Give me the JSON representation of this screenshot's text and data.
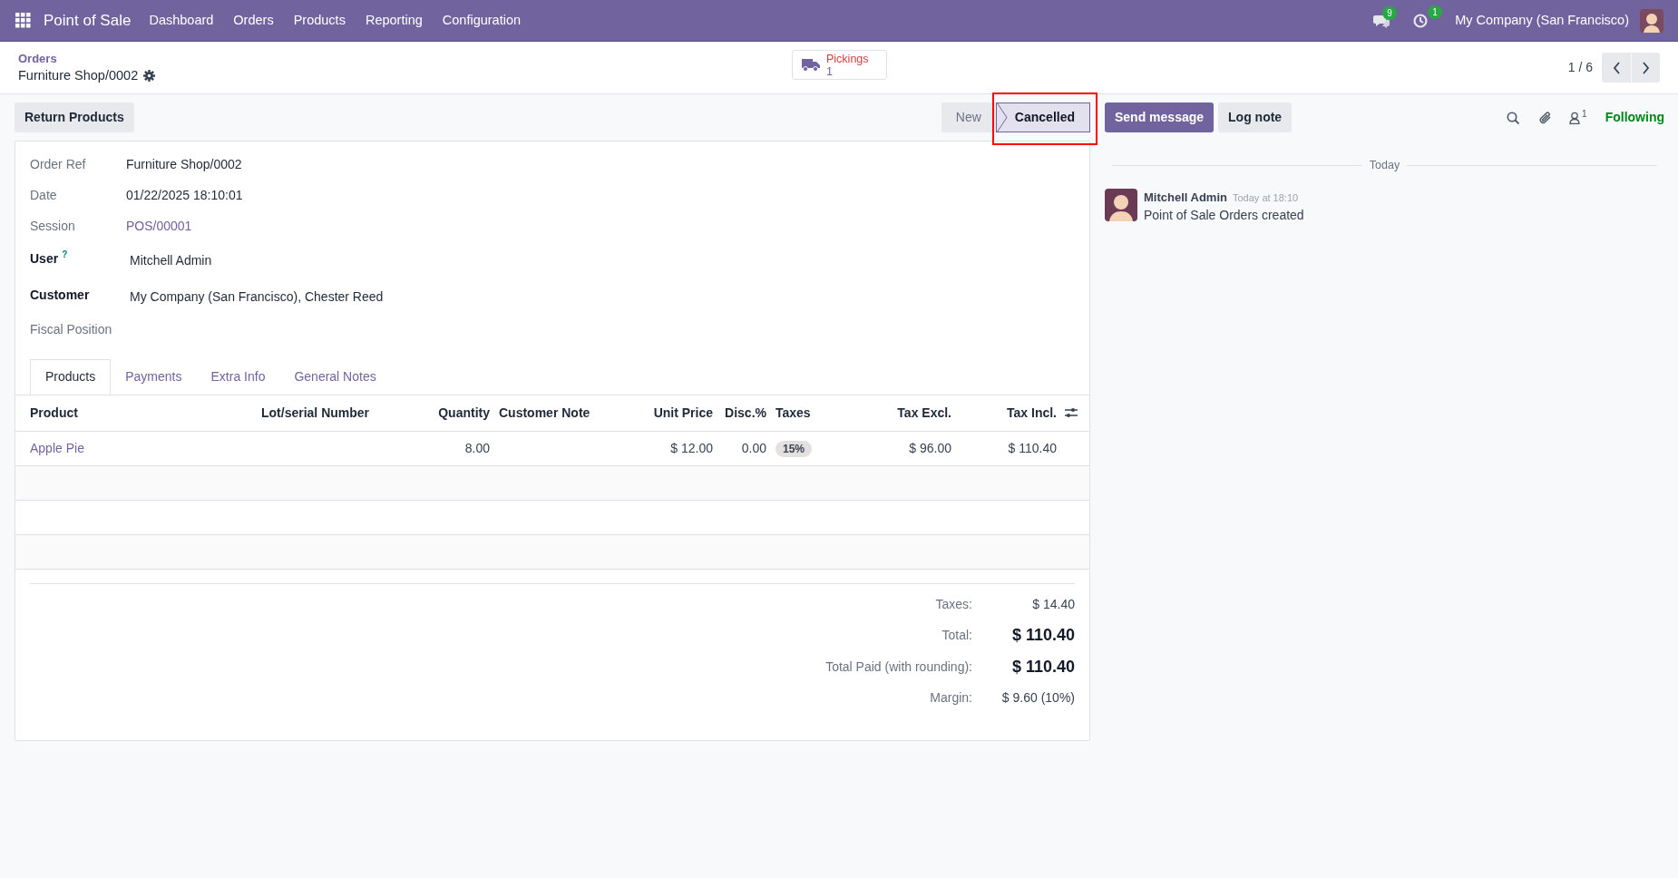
{
  "navbar": {
    "app_name": "Point of Sale",
    "menu": [
      "Dashboard",
      "Orders",
      "Products",
      "Reporting",
      "Configuration"
    ],
    "messages_count": "9",
    "activities_count": "1",
    "company": "My Company (San Francisco)"
  },
  "breadcrumb": {
    "parent": "Orders",
    "current": "Furniture Shop/0002"
  },
  "smart_button": {
    "label": "Pickings",
    "count": "1"
  },
  "pager": {
    "value": "1 / 6"
  },
  "actions": [
    "Return Products"
  ],
  "statusbar": [
    {
      "label": "New",
      "selected": false
    },
    {
      "label": "Cancelled",
      "selected": true
    }
  ],
  "chatter": {
    "buttons": [
      {
        "label": "Send message",
        "primary": true
      },
      {
        "label": "Log note",
        "primary": false
      }
    ],
    "followers_count": "1",
    "follow_label": "Following",
    "date_separator": "Today",
    "messages": [
      {
        "author": "Mitchell Admin",
        "time": "Today at 18:10",
        "body": "Point of Sale Orders created"
      }
    ]
  },
  "form": {
    "fields": [
      {
        "label": "Order Ref",
        "value": "Furniture Shop/0002",
        "kind": "text",
        "emphasized": false
      },
      {
        "label": "Date",
        "value": "01/22/2025 18:10:01",
        "kind": "text",
        "emphasized": false
      },
      {
        "label": "Session",
        "value": "POS/00001",
        "kind": "link",
        "emphasized": false
      },
      {
        "label": "User",
        "help": "?",
        "value": "Mitchell Admin",
        "kind": "text",
        "emphasized": true
      },
      {
        "label": "Customer",
        "value": "My Company (San Francisco), Chester Reed",
        "kind": "text",
        "emphasized": true
      },
      {
        "label": "Fiscal Position",
        "emphasized": false
      }
    ],
    "tabs": [
      {
        "label": "Products",
        "selected": true
      },
      {
        "label": "Payments",
        "selected": false
      },
      {
        "label": "Extra Info",
        "selected": false
      },
      {
        "label": "General Notes",
        "selected": false
      }
    ],
    "table": {
      "columns": [
        "Product",
        "Lot/serial Number",
        "Quantity",
        "Customer Note",
        "Unit Price",
        "Disc.%",
        "Taxes",
        "Tax Excl.",
        "Tax Incl."
      ],
      "rows": [
        {
          "product": "Apple Pie",
          "quantity": "8.00",
          "unit_price": "$ 12.00",
          "discount": "0.00",
          "taxes": [
            "15%"
          ],
          "tax_excl": "$ 96.00",
          "tax_incl": "$ 110.40"
        }
      ]
    },
    "totals": [
      {
        "label": "Taxes:",
        "value": "$ 14.40",
        "emphasized": false
      },
      {
        "label": "Total:",
        "value": "$ 110.40",
        "emphasized": true
      },
      {
        "label": "Total Paid (with rounding):",
        "value": "$ 110.40",
        "emphasized": true
      },
      {
        "label": "Margin:",
        "value": "$ 9.60 (10%)",
        "emphasized": false
      }
    ]
  }
}
